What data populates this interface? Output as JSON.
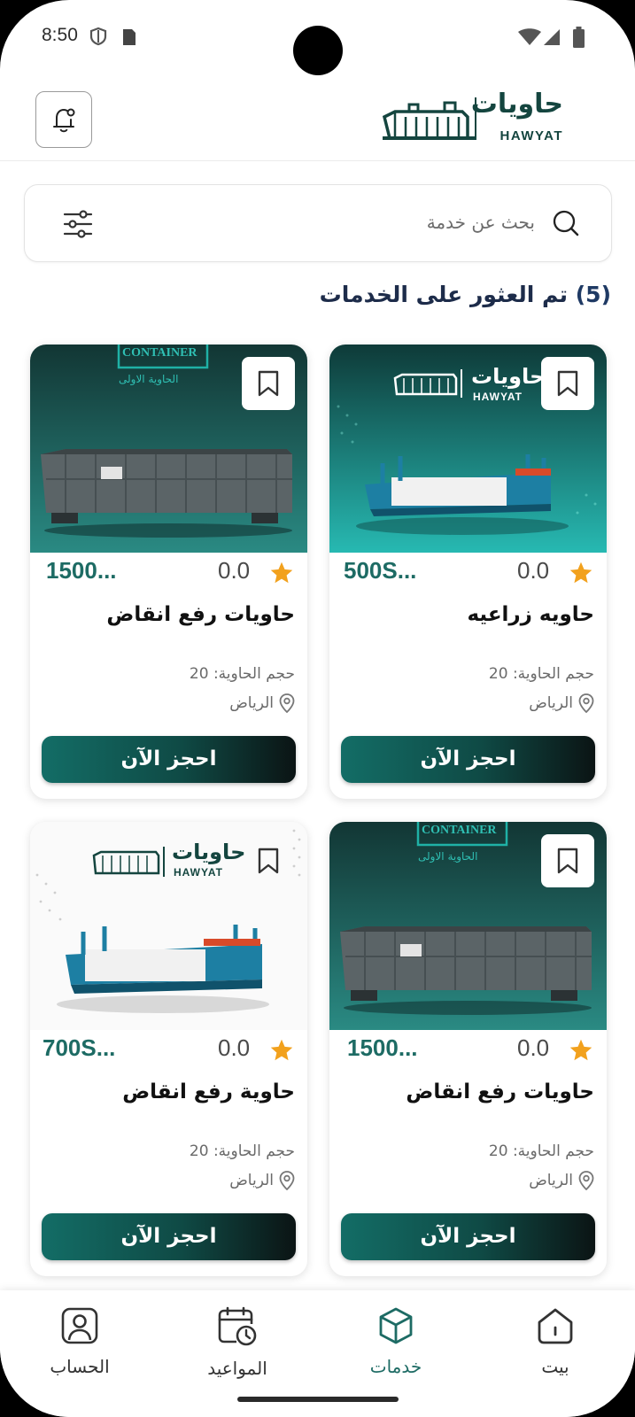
{
  "status_bar": {
    "time": "8:50"
  },
  "header": {
    "brand_ar": "حاويات",
    "brand_en": "HAWYAT",
    "notification_icon": "bell-icon"
  },
  "search": {
    "placeholder": "بحث عن خدمة"
  },
  "results": {
    "count": "(5)",
    "label": "تم العثور على الخدمات"
  },
  "cards": [
    {
      "image": "teal-branded-container",
      "rating": "0.0",
      "price": "500S...",
      "title": "حاويه زراعيه",
      "size": "حجم الحاوية: 20",
      "location": "الرياض",
      "book_label": "احجز الآن"
    },
    {
      "image": "grey-container-dark",
      "rating": "0.0",
      "price": "1500...",
      "title": "حاويات رفع انقاض",
      "size": "حجم الحاوية: 20",
      "location": "الرياض",
      "book_label": "احجز الآن"
    },
    {
      "image": "grey-container-dark",
      "rating": "0.0",
      "price": "1500...",
      "title": "حاويات رفع انقاض",
      "size": "حجم الحاوية: 20",
      "location": "الرياض",
      "book_label": "احجز الآن"
    },
    {
      "image": "teal-branded-container-white",
      "rating": "0.0",
      "price": "700S...",
      "title": "حاوية رفع انقاض",
      "size": "حجم الحاوية: 20",
      "location": "الرياض",
      "book_label": "احجز الآن"
    }
  ],
  "image_text": {
    "container_sign": "CONTAINER",
    "container_sign_ar": "الحاوية الاولى"
  },
  "bottom_nav": {
    "items": [
      {
        "label": "الحساب",
        "icon": "account-icon"
      },
      {
        "label": "المواعيد",
        "icon": "calendar-clock-icon"
      },
      {
        "label": "خدمات",
        "icon": "box-icon",
        "active": true
      },
      {
        "label": "بيت",
        "icon": "home-icon"
      }
    ]
  },
  "colors": {
    "accent": "#1d6b64",
    "brand": "#14453f",
    "star": "#f2a11d"
  }
}
